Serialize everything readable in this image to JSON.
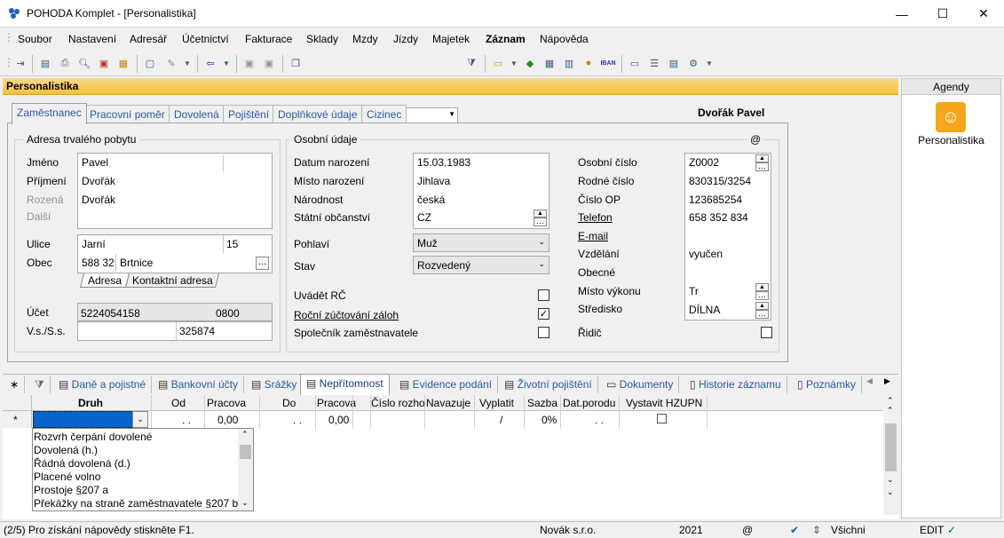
{
  "window": {
    "title": "POHODA Komplet - [Personalistika]",
    "minimize_icon": "minimize-icon",
    "maximize_icon": "maximize-icon",
    "close_icon": "close-icon"
  },
  "menu": [
    "Soubor",
    "Nastavení",
    "Adresář",
    "Účetnictví",
    "Fakturace",
    "Sklady",
    "Mzdy",
    "Jízdy",
    "Majetek",
    "Záznam",
    "Nápověda"
  ],
  "agenda_title": "Personalistika",
  "right_panel": {
    "header": "Agendy",
    "item_label": "Personalistika"
  },
  "tabs": [
    "Zaměstnanec",
    "Pracovní poměr",
    "Dovolená",
    "Pojištění",
    "Doplňkové údaje",
    "Cizinec"
  ],
  "person_name": "Dvořák Pavel",
  "address_group": {
    "title": "Adresa trvalého pobytu",
    "jmeno_label": "Jméno",
    "jmeno": "Pavel",
    "prijmeni_label": "Příjmení",
    "prijmeni": "Dvořák",
    "rozena_label": "Rozená",
    "rozena": "Dvořák",
    "dalsi_label": "Další",
    "ulice_label": "Ulice",
    "ulice": "Jarní",
    "cislo": "15",
    "obec_label": "Obec",
    "psc": "588 32",
    "obec": "Brtnice",
    "addr_tab1": "Adresa",
    "addr_tab2": "Kontaktní adresa",
    "ucet_label": "Účet",
    "ucet": "5224054158",
    "kod_banky": "0800",
    "vs_label": "V.s./S.s.",
    "vs": "325874"
  },
  "personal_group": {
    "title": "Osobní údaje",
    "at_sign": "@",
    "datum_label": "Datum narození",
    "datum": "15.03.1983",
    "misto_label": "Místo narození",
    "misto": "Jihlava",
    "narodnost_label": "Národnost",
    "narodnost": "česká",
    "obcanstvi_label": "Státní občanství",
    "obcanstvi": "CZ",
    "pohlavi_label": "Pohlaví",
    "pohlavi": "Muž",
    "stav_label": "Stav",
    "stav": "Rozvedený",
    "uvadet_rc_label": "Uvádět RČ",
    "rocni_label": "Roční zúčtování záloh",
    "spolecnik_label": "Společník zaměstnavatele",
    "osobni_cislo_label": "Osobní číslo",
    "osobni_cislo": "Z0002",
    "rodne_cislo_label": "Rodné číslo",
    "rodne_cislo": "830315/3254",
    "cislo_op_label": "Číslo OP",
    "cislo_op": "123685254",
    "telefon_label": "Telefon",
    "telefon": "658 352 834",
    "email_label": "E-mail",
    "vzdelani_label": "Vzdělání",
    "vzdelani": "vyučen",
    "obecne_label": "Obecné",
    "misto_vykonu_label": "Místo výkonu",
    "misto_vykonu": "Tr",
    "stredisko_label": "Středisko",
    "stredisko": "DÍLNA",
    "ridic_label": "Řidič"
  },
  "bottom_tabs": [
    "Daně a pojistné",
    "Bankovní účty",
    "Srážky",
    "Nepřítomnost",
    "Evidence podání",
    "Životní pojištění",
    "Dokumenty",
    "Historie záznamu",
    "Poznámky"
  ],
  "grid": {
    "columns": [
      "Druh",
      "Od",
      "Pracova",
      "Do",
      "Pracova",
      "Číslo rozho",
      "Navazuje",
      "Vyplatit",
      "Sazba",
      "Dat.porodu",
      "Vystavit HZUPN"
    ],
    "row": {
      "marker": "*",
      "od": ". .",
      "pracova1": "0,00",
      "do": ". .",
      "pracova2": "0,00",
      "vyplatit": "/",
      "sazba": "0%",
      "dat_porodu": ". ."
    },
    "dropdown": [
      "Rozvrh čerpání dovolené",
      "Dovolená (h.)",
      "Řádná dovolená (d.)",
      "Placené volno",
      "Prostoje §207 a",
      "Překážky na straně zaměstnavatele §207 b"
    ]
  },
  "status": {
    "help": "(2/5) Pro získání nápovědy stiskněte F1.",
    "company": "Novák s.r.o.",
    "year": "2021",
    "at": "@",
    "filter": "Všichni",
    "mode": "EDIT"
  }
}
